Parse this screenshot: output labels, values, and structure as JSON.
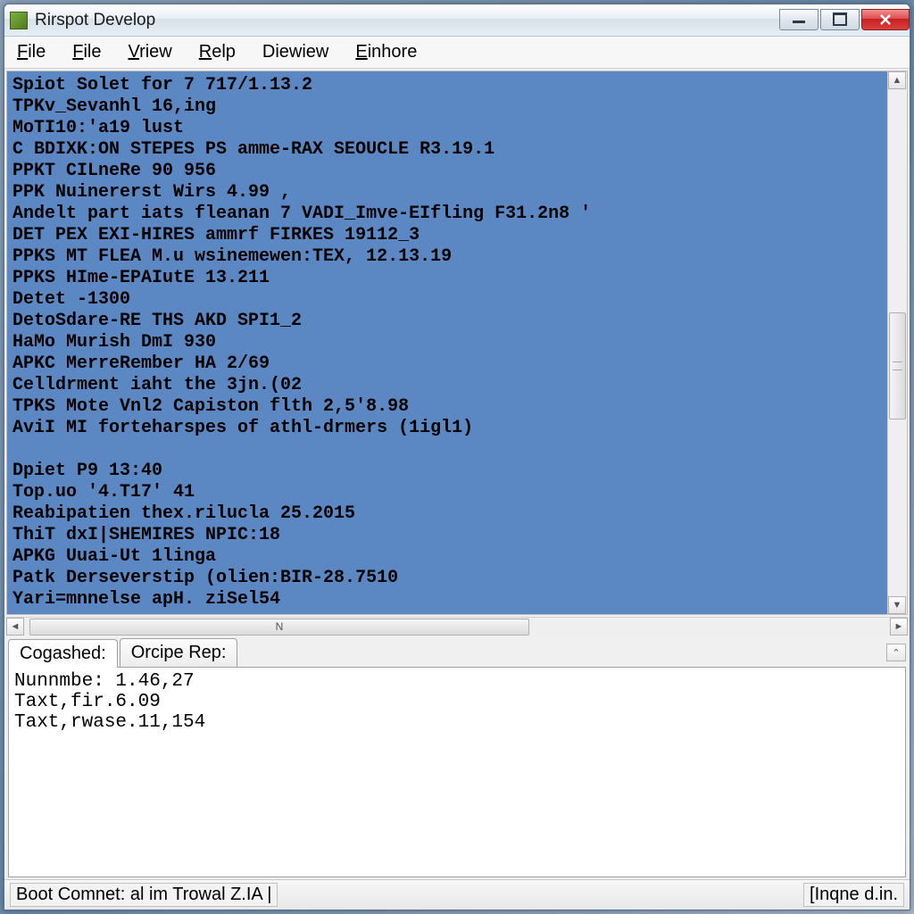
{
  "window": {
    "title": "Rirspot Develop"
  },
  "menu": {
    "items": [
      {
        "label": "File",
        "accel": "F"
      },
      {
        "label": "File",
        "accel": "F"
      },
      {
        "label": "Vriew",
        "accel": "V"
      },
      {
        "label": "Relp",
        "accel": "R"
      },
      {
        "label": "Diewiew",
        "accel": ""
      },
      {
        "label": "Einhore",
        "accel": "E"
      }
    ]
  },
  "editor": {
    "lines": [
      "Spiot Solet for 7 717/1.13.2",
      "TPKv_Sevanhl 16,ing",
      "MoTI10:'a19 lust",
      "C BDIXK:ON STEPES PS amme-RAX SEOUCLE R3.19.1",
      "PPKT CILneRe 90 956",
      "PPK Nuinererst Wirs 4.99 ,",
      "Andelt part iats fleanan 7 VADI_Imve-EIfling F31.2n8 '",
      "DET PEX EXI-HIRES ammrf FIRKES 19112_3",
      "PPKS MT FLEA M.u wsinemewen:TEX, 12.13.19",
      "PPKS HIme-EPAIutE 13.211",
      "Detet -1300",
      "DetoSdare-RE THS AKD SPI1_2",
      "HaMo Murish DmI 930",
      "APKC MerreRember HA 2/69",
      "Celldrment iaht the 3jn.(02",
      "TPKS Mote Vnl2 Capiston flth 2,5'8.98",
      "AviI MI forteharspes of athl-drmers (1igl1)",
      "",
      "Dpiet P9 13:40",
      "Top.uo '4.T17' 41",
      "Reabipatien thex.rilucla 25.2015",
      "ThiT dxI|SHEMIRES NPIC:18",
      "APKG Uuai-Ut 1linga",
      "Patk Derseverstip (olien:BIR-28.7510",
      "Yari=mnnelse apH. ziSel54"
    ]
  },
  "hscroll_label": "N",
  "tabs": {
    "items": [
      {
        "label": "Cogashed:"
      },
      {
        "label": "Orcipe Rep:"
      }
    ]
  },
  "output": {
    "lines": [
      "Nunnmbe: 1.46,27",
      "Taxt,fir.6.09",
      "Taxt,rwase.11,154"
    ]
  },
  "status": {
    "left": "Boot Comnet: al im Trowal Z.IA |",
    "right": "[Inqne d.in."
  }
}
